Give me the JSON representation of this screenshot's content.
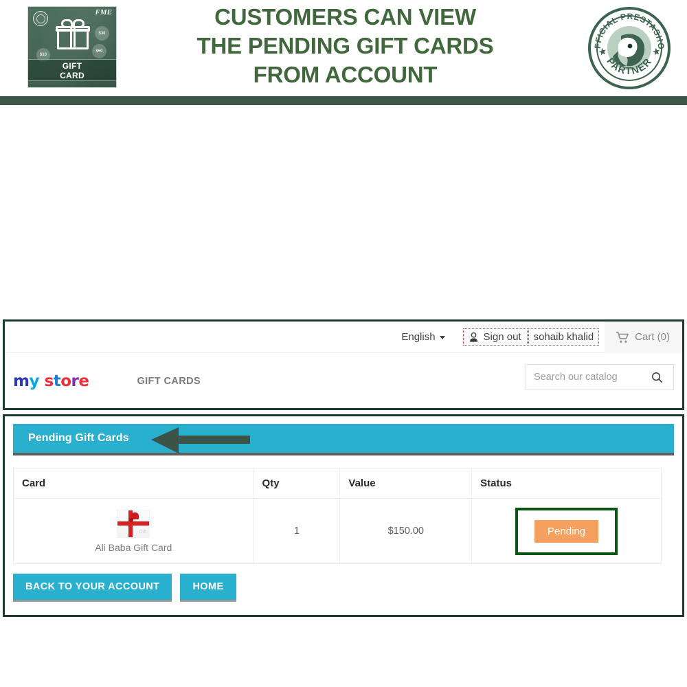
{
  "banner": {
    "product_card": {
      "title_line1": "GIFT",
      "title_line2": "CARD",
      "brand_mark": "FME",
      "coins": [
        "$30",
        "$50",
        "$10"
      ]
    },
    "headline_lines": [
      "CUSTOMERS CAN VIEW",
      "THE PENDING GIFT CARDS",
      "FROM ACCOUNT"
    ],
    "headline_color": "#41683c",
    "badge": {
      "top_text": "OFFICIAL PRESTASHOP",
      "bottom_text": "PARTNER"
    }
  },
  "store": {
    "top_nav": {
      "language": "English",
      "sign_out": "Sign out",
      "customer_name": "sohaib khalid",
      "cart": "Cart (0)"
    },
    "logo": {
      "part1": "m",
      "part2": "y",
      "part3": "s",
      "part4": "t",
      "part5": "o",
      "part6": "r",
      "part7": "e"
    },
    "nav_link": "GIFT CARDS",
    "search": {
      "placeholder": "Search our catalog",
      "value": ""
    }
  },
  "panel": {
    "title": "Pending Gift Cards",
    "accent_color": "#29b0ce",
    "table": {
      "headers": [
        "Card",
        "Qty",
        "Value",
        "Status"
      ],
      "rows": [
        {
          "card_name": "Ali Baba Gift Card",
          "qty": "1",
          "value": "$150.00",
          "status": "Pending",
          "status_color": "#f5a05e"
        }
      ]
    },
    "buttons": {
      "back": "BACK TO YOUR ACCOUNT",
      "home": "HOME"
    }
  }
}
